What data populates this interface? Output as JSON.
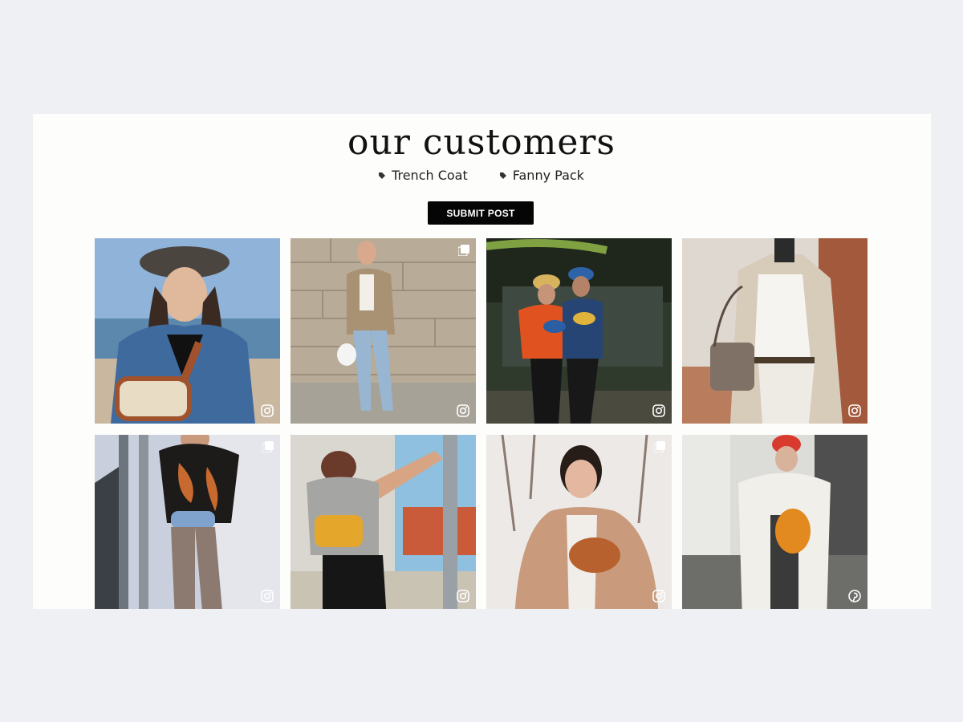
{
  "section": {
    "title": "our customers",
    "tags": [
      {
        "label": "Trench Coat",
        "icon": "tag-icon"
      },
      {
        "label": "Fanny Pack",
        "icon": "tag-icon"
      }
    ],
    "submit_label": "SUBMIT POST"
  },
  "colors": {
    "page_background": "#eff0f4",
    "card_background": "#fdfdfc",
    "button_background": "#050505",
    "button_text": "#ffffff"
  },
  "gallery": [
    {
      "name": "post-bucket-hat-fanny-pack",
      "source_icon": "instagram-icon",
      "multiple_images": false
    },
    {
      "name": "post-blazer-white-bag",
      "source_icon": "instagram-icon",
      "multiple_images": true
    },
    {
      "name": "post-couple-bucket-hats",
      "source_icon": "instagram-icon",
      "multiple_images": false
    },
    {
      "name": "post-trench-coat-handbag",
      "source_icon": "instagram-icon",
      "multiple_images": false
    },
    {
      "name": "post-tie-dye-shirt-fanny-pack",
      "source_icon": "instagram-icon",
      "multiple_images": true
    },
    {
      "name": "post-yellow-fanny-pack",
      "source_icon": "instagram-icon",
      "multiple_images": false
    },
    {
      "name": "post-snow-teddy-coat",
      "source_icon": "instagram-icon",
      "multiple_images": true
    },
    {
      "name": "post-white-puffer-coat",
      "source_icon": "pinterest-icon",
      "multiple_images": false
    }
  ]
}
